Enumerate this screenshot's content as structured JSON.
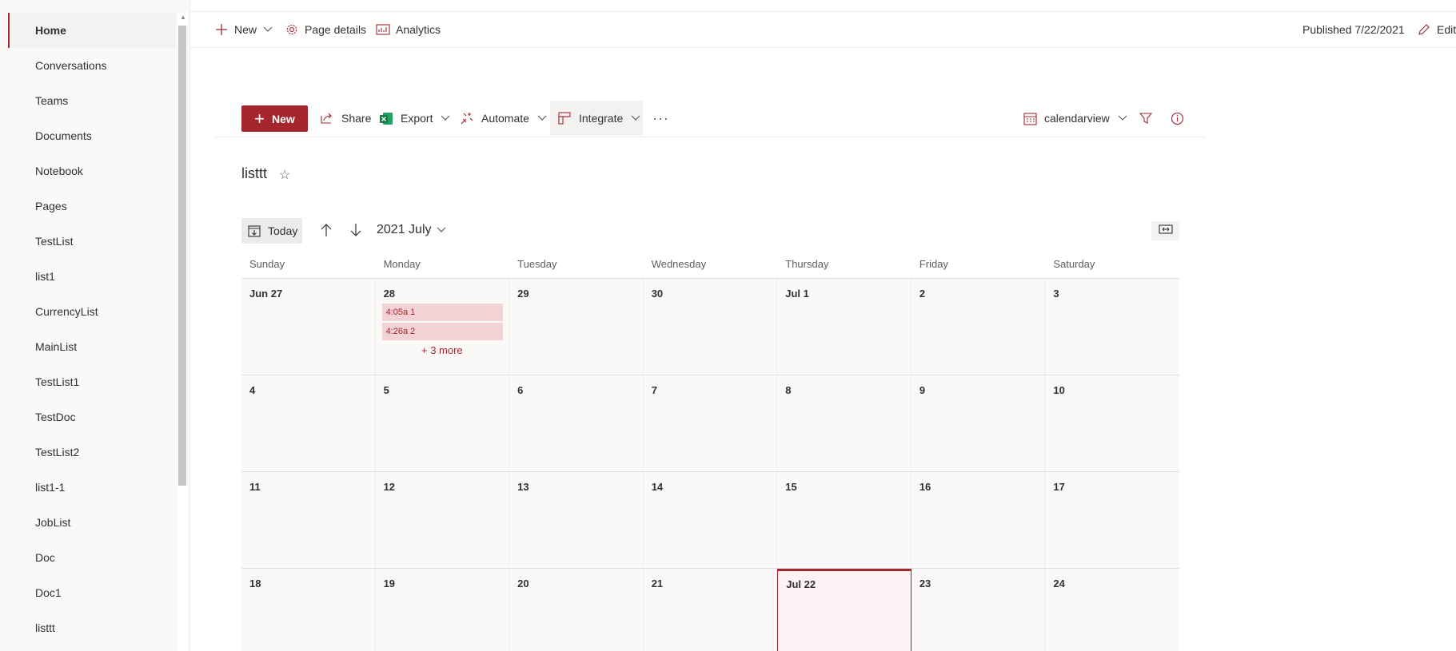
{
  "nav": {
    "items": [
      {
        "label": "Home",
        "active": true
      },
      {
        "label": "Conversations"
      },
      {
        "label": "Teams"
      },
      {
        "label": "Documents"
      },
      {
        "label": "Notebook"
      },
      {
        "label": "Pages"
      },
      {
        "label": "TestList"
      },
      {
        "label": "list1"
      },
      {
        "label": "CurrencyList"
      },
      {
        "label": "MainList"
      },
      {
        "label": "TestList1"
      },
      {
        "label": "TestDoc"
      },
      {
        "label": "TestList2"
      },
      {
        "label": "list1-1"
      },
      {
        "label": "JobList"
      },
      {
        "label": "Doc"
      },
      {
        "label": "Doc1"
      },
      {
        "label": "listtt"
      }
    ]
  },
  "topbar": {
    "new_label": "New",
    "page_details_label": "Page details",
    "analytics_label": "Analytics",
    "published_label": "Published 7/22/2021",
    "edit_label": "Edit"
  },
  "cmdbar": {
    "new_label": "New",
    "share_label": "Share",
    "export_label": "Export",
    "automate_label": "Automate",
    "integrate_label": "Integrate",
    "more_label": "···",
    "view_label": "calendarview"
  },
  "list": {
    "title": "listtt"
  },
  "calendar": {
    "today_label": "Today",
    "month_label": "2021 July",
    "days_of_week": [
      "Sunday",
      "Monday",
      "Tuesday",
      "Wednesday",
      "Thursday",
      "Friday",
      "Saturday"
    ],
    "weeks": [
      [
        "Jun 27",
        "28",
        "29",
        "30",
        "Jul 1",
        "2",
        "3"
      ],
      [
        "4",
        "5",
        "6",
        "7",
        "8",
        "9",
        "10"
      ],
      [
        "11",
        "12",
        "13",
        "14",
        "15",
        "16",
        "17"
      ],
      [
        "18",
        "19",
        "20",
        "21",
        "Jul 22",
        "23",
        "24"
      ]
    ],
    "events": [
      {
        "label": "4:05a 1"
      },
      {
        "label": "4:26a 2"
      }
    ],
    "more_label": "+ 3 more"
  },
  "colors": {
    "accent": "#a4262c",
    "event_bg": "#f1d3d6",
    "today_bg": "#fdf3f4",
    "excel_green": "#107c41"
  }
}
